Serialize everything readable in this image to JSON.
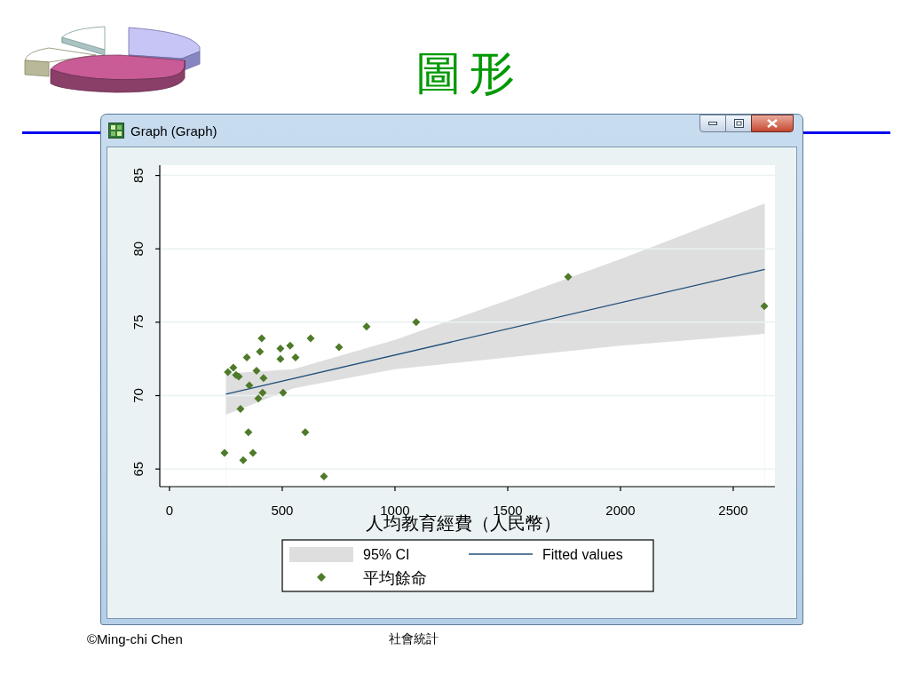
{
  "slide": {
    "title": "圖形",
    "footer_left": "©Ming-chi Chen",
    "footer_center": "社會統計"
  },
  "window": {
    "title": "Graph (Graph)"
  },
  "graph": {
    "chart_data": {
      "type": "scatter",
      "xlabel": "人均教育經費（人民幣）",
      "xlim": [
        -43,
        2685
      ],
      "ylim": [
        63.8,
        85.7
      ],
      "xticks": [
        0,
        500,
        1000,
        1500,
        2000,
        2500
      ],
      "yticks": [
        65,
        70,
        75,
        80,
        85
      ],
      "grid": true,
      "legend": "bottom",
      "series": [
        {
          "name": "95% CI",
          "type": "area",
          "color": "#dedede",
          "x": [
            250,
            550,
            1000,
            1500,
            2000,
            2640
          ],
          "values": [
            71.5,
            71.8,
            73.8,
            76.5,
            79.3,
            83.1
          ]
        },
        {
          "type": "area",
          "color": "#ffffff",
          "x": [
            250,
            550,
            1000,
            1500,
            2000,
            2640
          ],
          "values": [
            68.7,
            70.5,
            71.8,
            72.6,
            73.4,
            74.2
          ]
        },
        {
          "name": "Fitted values",
          "type": "line",
          "color": "#1f4f7a",
          "x": [
            250,
            2640
          ],
          "values": [
            70.1,
            78.6
          ]
        },
        {
          "name": "平均餘命",
          "type": "scatter",
          "color": "#4e7a2a",
          "x": [
            244,
            259,
            283,
            295,
            307,
            315,
            327,
            343,
            354,
            350,
            370,
            386,
            394,
            401,
            409,
            417,
            413,
            492,
            492,
            504,
            535,
            559,
            602,
            626,
            685,
            752,
            874,
            1094,
            1768,
            2638
          ],
          "values": [
            66.1,
            71.6,
            71.9,
            71.4,
            71.3,
            69.1,
            65.6,
            72.6,
            70.7,
            67.5,
            66.1,
            71.7,
            69.8,
            73.0,
            73.9,
            71.2,
            70.2,
            73.2,
            72.5,
            70.2,
            73.4,
            72.6,
            67.5,
            73.9,
            64.5,
            73.3,
            74.7,
            75.0,
            78.1,
            76.1
          ]
        }
      ]
    }
  }
}
